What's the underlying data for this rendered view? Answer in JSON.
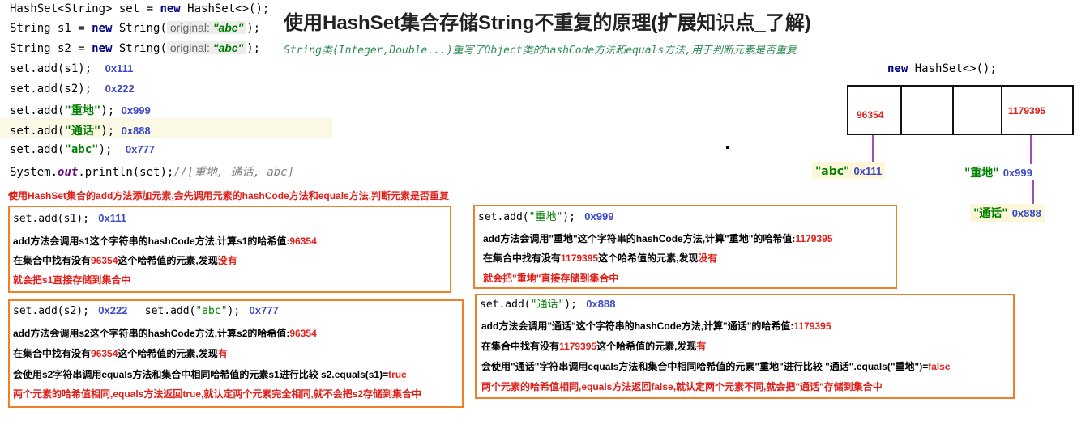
{
  "code": {
    "line1": {
      "a": "HashSet<String> set = ",
      "kw": "new",
      "b": " HashSet<>();"
    },
    "line2": {
      "a": "String s1 = ",
      "kw": "new",
      "b": " String(",
      "hint_label": "original:",
      "hint_val": "\"abc\"",
      "c": ");"
    },
    "line3": {
      "a": "String s2 = ",
      "kw": "new",
      "b": " String(",
      "hint_label": "original:",
      "hint_val": "\"abc\"",
      "c": ");"
    },
    "line4": {
      "a": "set.add(s1);",
      "addr": "0x111"
    },
    "line5": {
      "a": "set.add(s2);",
      "addr": "0x222"
    },
    "line6": {
      "a": "set.add(",
      "s": "\"重地\"",
      "b": ");",
      "addr": "0x999"
    },
    "line7": {
      "a": "set.add(",
      "s": "\"通话\"",
      "b": ");",
      "addr": "0x888"
    },
    "line8": {
      "a": "set.add(",
      "s": "\"abc\"",
      "b": ");",
      "addr": "0x777"
    },
    "line9": {
      "a": "System.",
      "out": "out",
      "b": ".println(set);",
      "c": "//[重地, 通话, abc]"
    }
  },
  "title": "使用HashSet集合存储String不重复的原理(扩展知识点_了解)",
  "subtitle": "String类(Integer,Double...)重写了Object类的hashCode方法和equals方法,用于判断元素是否重复",
  "diagram": {
    "label": {
      "kw": "new",
      "rest": " HashSet<>();"
    },
    "cell1": "96354",
    "cell4": "1179395",
    "tag_abc": {
      "s": "\"abc\"",
      "addr": "0x111"
    },
    "tag_zd": {
      "pre": "“",
      "s": "\"重地\"",
      "addr": "0x999"
    },
    "tag_th": {
      "s": "\"通话\"",
      "addr": "0x888"
    }
  },
  "note": "使用HashSet集合的add方法添加元素,会先调用元素的hashCode方法和equals方法,判断元素是否重复",
  "box1": {
    "code": "set.add(s1);",
    "addr": "0x111",
    "l1a": "add方法会调用s1这个字符串的hashCode方法,计算s1的哈希值:",
    "l1b": "96354",
    "l2a": "在集合中找有没有",
    "l2b": "96354",
    "l2c": "这个哈希值的元素,发现",
    "l2d": "没有",
    "l3": "就会把s1直接存储到集合中"
  },
  "box2": {
    "code1": "set.add(s2);",
    "addr1": "0x222",
    "code2a": "set.add(",
    "code2s": "\"abc\"",
    "code2b": ");",
    "addr2": "0x777",
    "l1a": "add方法会调用s2这个字符串的hashCode方法,计算s2的哈希值:",
    "l1b": "96354",
    "l2a": "在集合中找有没有",
    "l2b": "96354",
    "l2c": "这个哈希值的元素,发现",
    "l2d": "有",
    "l3a": "会使用s2字符串调用equals方法和集合中相同哈希值的元素s1进行比较 s2.equals(s1)=",
    "l3b": "true",
    "l4": "两个元素的哈希值相同,equals方法返回true,就认定两个元素完全相同,就不会把s2存储到集合中"
  },
  "box3": {
    "code_a": "set.add(",
    "code_s": "\"重地\"",
    "code_b": ");",
    "addr": "0x999",
    "l1a": "add方法会调用\"重地\"这个字符串的hashCode方法,计算\"重地\"的哈希值:",
    "l1b": "1179395",
    "l2a": "在集合中找有没有",
    "l2b": "1179395",
    "l2c": "这个哈希值的元素,发现",
    "l2d": "没有",
    "l3": "就会把\"重地\"直接存储到集合中"
  },
  "box4": {
    "code_a": "set.add(",
    "code_s": "\"通话\"",
    "code_b": ");",
    "addr": "0x888",
    "l1a": "add方法会调用\"通话\"这个字符串的hashCode方法,计算\"通话\"的哈希值:",
    "l1b": "1179395",
    "l2a": "在集合中找有没有",
    "l2b": "1179395",
    "l2c": "这个哈希值的元素,发现",
    "l2d": "有",
    "l3a": "会使用\"通话\"字符串调用equals方法和集合中相同哈希值的元素\"重地\"进行比较 \"通话\".equals(\"重地\")=",
    "l3b": "false",
    "l4": "两个元素的哈希值相同,equals方法返回false,就认定两个元素不同,就会把\"通话\"存储到集合中"
  },
  "colors": {
    "orange_border": "#f07f2a",
    "red": "#e0201a",
    "address_blue": "#3b49c8",
    "string_green": "#008000",
    "purple_line": "#a050b0"
  }
}
